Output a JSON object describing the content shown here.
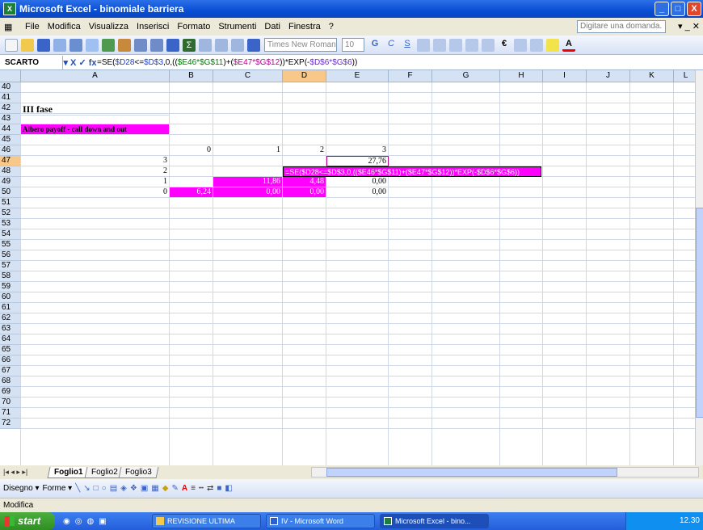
{
  "title": "Microsoft Excel - binomiale barriera",
  "window_buttons": {
    "minimize": "_",
    "maximize": "□",
    "close": "X"
  },
  "menu": [
    "File",
    "Modifica",
    "Visualizza",
    "Inserisci",
    "Formato",
    "Strumenti",
    "Dati",
    "Finestra",
    "?"
  ],
  "ask_placeholder": "Digitare una domanda.",
  "toolbar": {
    "font": "Times New Roman",
    "size": "10",
    "currency": "€"
  },
  "namebox": "SCARTO",
  "formula_icons": "▾ X ✓ fx",
  "formula": {
    "p1": "=SE(",
    "p2": "$D28",
    "p3": "<=",
    "p4": "$D$3",
    "p5": ",0,((",
    "p6": "$E46",
    "p7": "*",
    "p8": "$G$11",
    "p9": ")+(",
    "p10": "$E47",
    "p11": "*",
    "p12": "$G$12",
    "p13": "))*EXP(-",
    "p14": "$D$6",
    "p15": "*",
    "p16": "$G$6",
    "p17": "))"
  },
  "columns": [
    "A",
    "B",
    "C",
    "D",
    "E",
    "F",
    "G",
    "H",
    "I",
    "J",
    "K",
    "L"
  ],
  "rows": [
    "40",
    "41",
    "42",
    "43",
    "44",
    "45",
    "46",
    "47",
    "48",
    "49",
    "50",
    "51",
    "52",
    "53",
    "54",
    "55",
    "56",
    "57",
    "58",
    "59",
    "60",
    "61",
    "62",
    "63",
    "64",
    "65",
    "66",
    "67",
    "68",
    "69",
    "70",
    "71",
    "72"
  ],
  "cells": {
    "a41": "III fase",
    "a43": "Albero payoff - call down and out",
    "b45": "0",
    "c45": "1",
    "d45": "2",
    "e45": "3",
    "a46": "3",
    "e46": "27,76",
    "a47": "2",
    "d47": "=SE($D28<=$D$3,0,(($E46*$G$11)+($E47*$G$12))*EXP(-$D$6*$G$6))",
    "a48": "1",
    "c48": "11,86",
    "d48": "4,48",
    "e48": "0,00",
    "a49": "0",
    "b49": "6,24",
    "c49": "0,00",
    "d49": "0,00",
    "e49": "0,00"
  },
  "sheets": [
    "Foglio1",
    "Foglio2",
    "Foglio3"
  ],
  "sheet_nav": "|◂ ◂ ▸ ▸|",
  "draw_menu": "Disegno ▾",
  "shapes_menu": "Forme ▾",
  "status": "Modifica",
  "taskbar": {
    "start": "start",
    "items": [
      "REVISIONE ULTIMA",
      "IV - Microsoft Word",
      "Microsoft Excel - bino..."
    ],
    "clock": "12.30"
  },
  "colors": {
    "magenta": "#ff00ff",
    "title_blue": "#0a4fd4"
  }
}
